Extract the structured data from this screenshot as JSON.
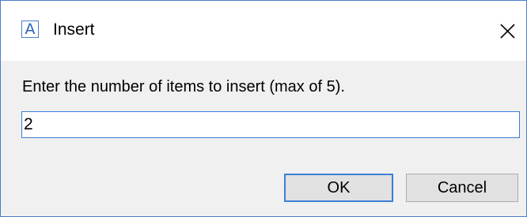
{
  "window": {
    "icon_glyph": "A",
    "icon_name": "app-a-icon",
    "title": "Insert",
    "close_icon": "close-icon"
  },
  "dialog": {
    "prompt": "Enter the number of items to insert (max of 5).",
    "input_value": "2",
    "ok_label": "OK",
    "cancel_label": "Cancel"
  },
  "colors": {
    "border_accent": "#4a7ec9",
    "dialog_bg": "#f0f0f0",
    "titlebar_bg": "#ffffff",
    "button_bg": "#e1e1e1",
    "default_button_border": "#3c7fd4"
  }
}
